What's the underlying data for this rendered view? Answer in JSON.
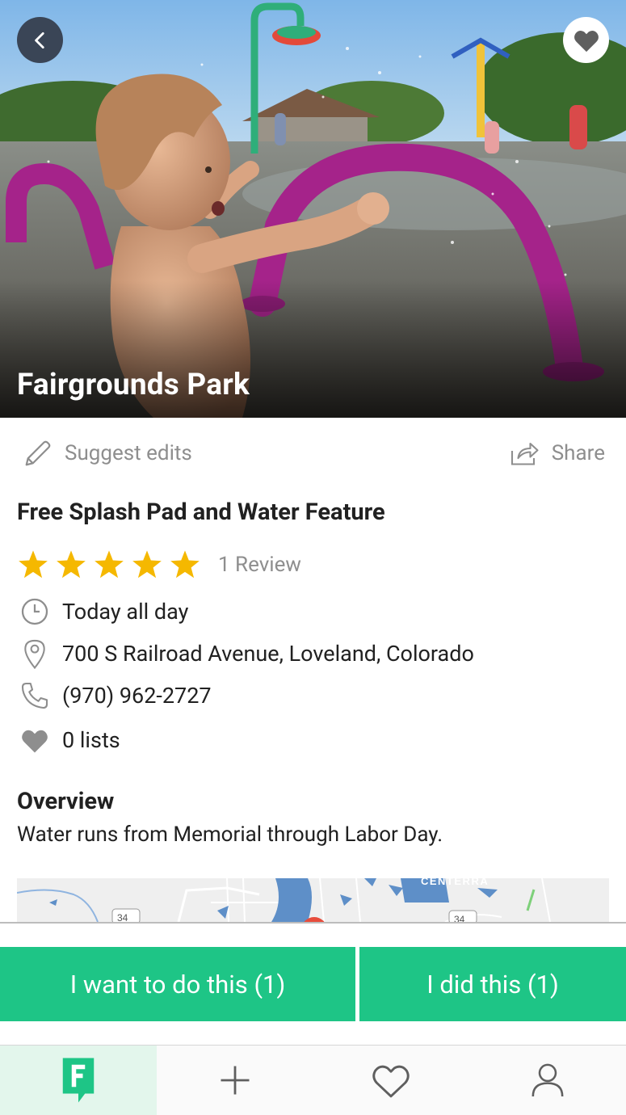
{
  "place": {
    "name": "Fairgrounds Park",
    "subtitle": "Free Splash Pad and Water Feature",
    "rating": 5,
    "review_count_label": "1 Review",
    "hours": "Today all day",
    "address": "700 S Railroad Avenue, Loveland, Colorado",
    "phone": "(970) 962-2727",
    "lists_label": "0 lists"
  },
  "actions": {
    "suggest_label": "Suggest edits",
    "share_label": "Share"
  },
  "overview": {
    "heading": "Overview",
    "text": "Water runs from Memorial through Labor Day."
  },
  "map": {
    "labels": [
      "CENTERRA",
      "34",
      "34"
    ]
  },
  "cta": {
    "want_label": "I want to do this (1)",
    "did_label": "I did this (1)"
  },
  "nav": {
    "items": [
      "home-icon",
      "add-icon",
      "favorites-icon",
      "profile-icon"
    ],
    "active_index": 0
  },
  "colors": {
    "accent": "#1ec586",
    "star": "#f5b800",
    "back_button": "#3a4556",
    "muted_text": "#8e8e8e"
  }
}
